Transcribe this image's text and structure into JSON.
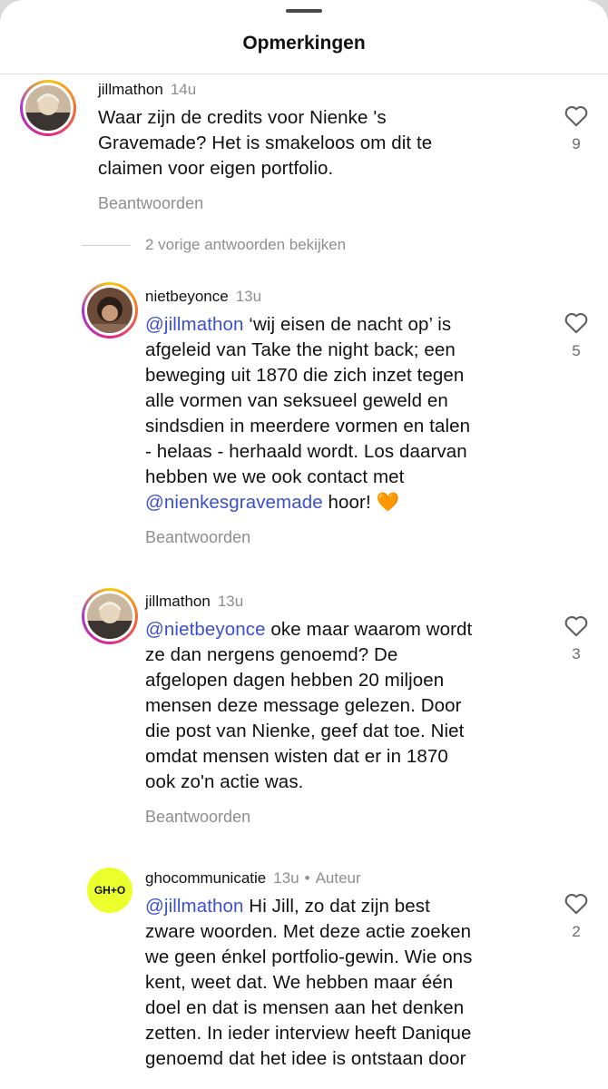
{
  "header": {
    "title": "Opmerkingen"
  },
  "view_replies": "2 vorige antwoorden bekijken",
  "comments": [
    {
      "user": "jillmathon",
      "time": "14u",
      "lines": [
        "Waar zijn de credits voor Nienke 's",
        "Gravemade? Het is smakeloos om dit te",
        "claimen voor eigen portfolio."
      ],
      "reply": "Beantwoorden",
      "likes": "9"
    },
    {
      "user": "nietbeyonce",
      "time": "13u",
      "mention1": "@jillmathon",
      "line1_rest": " ‘wij eisen de nacht op’ is",
      "lines": [
        "afgeleid van Take the night back; een",
        "beweging uit 1870 die zich inzet tegen",
        "alle vormen van seksueel geweld en",
        "sindsdien in meerdere vormen en talen",
        "- helaas - herhaald wordt. Los daarvan",
        "hebben we we ook contact met"
      ],
      "mention2": "@nienkesgravemade",
      "last_rest": " hoor! 🧡",
      "reply": "Beantwoorden",
      "likes": "5"
    },
    {
      "user": "jillmathon",
      "time": "13u",
      "mention1": "@nietbeyonce",
      "line1_rest": " oke maar waarom wordt",
      "lines": [
        "ze dan nergens genoemd? De",
        "afgelopen dagen hebben 20 miljoen",
        "mensen deze message gelezen. Door",
        "die post van Nienke, geef dat toe. Niet",
        "omdat mensen wisten dat er in 1870",
        "ook zo'n actie was."
      ],
      "reply": "Beantwoorden",
      "likes": "3"
    },
    {
      "user": "ghocommunicatie",
      "time": "13u",
      "dot": "•",
      "badge": "Auteur",
      "logo": "GH+O",
      "mention1": "@jillmathon",
      "line1_rest": " Hi Jill, zo dat zijn best",
      "lines": [
        "zware woorden. Met deze actie zoeken",
        "we geen énkel portfolio-gewin. Wie ons",
        "kent, weet dat. We hebben maar één",
        "doel en dat is mensen aan het denken",
        "zetten. In ieder interview heeft Danique",
        "genoemd dat het idee is ontstaan door"
      ],
      "likes": "2"
    }
  ],
  "icons": {
    "like": "heart-outline-icon"
  },
  "colors": {
    "mention": "#3b4fd1",
    "logo_bg": "#eaff2b",
    "meta": "#8e8e8e"
  }
}
